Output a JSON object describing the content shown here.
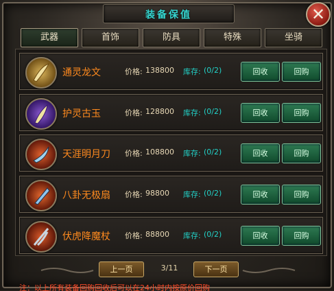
{
  "window": {
    "title": "装备保值",
    "close_glyph": "✕"
  },
  "tabs": [
    {
      "label": "武器",
      "active": true
    },
    {
      "label": "首饰",
      "active": false
    },
    {
      "label": "防具",
      "active": false
    },
    {
      "label": "特殊",
      "active": false
    },
    {
      "label": "坐骑",
      "active": false
    }
  ],
  "items": [
    {
      "name": "通灵龙文",
      "price_label": "价格:",
      "price": "138800",
      "stock_label": "库存:",
      "stock": "(0/2)",
      "sell": "回收",
      "rebuy": "回购",
      "icon": "dragon-blade-icon",
      "color": "#b28c2b"
    },
    {
      "name": "护灵古玉",
      "price_label": "价格:",
      "price": "128800",
      "stock_label": "库存:",
      "stock": "(0/2)",
      "sell": "回收",
      "rebuy": "回购",
      "icon": "jade-blade-icon",
      "color": "#5b2fa0"
    },
    {
      "name": "天涯明月刀",
      "price_label": "价格:",
      "price": "108800",
      "stock_label": "库存:",
      "stock": "(0/2)",
      "sell": "回收",
      "rebuy": "回购",
      "icon": "moon-saber-icon",
      "color": "#b5341c"
    },
    {
      "name": "八卦无极扇",
      "price_label": "价格:",
      "price": "98800",
      "stock_label": "库存:",
      "stock": "(0/2)",
      "sell": "回收",
      "rebuy": "回购",
      "icon": "bagua-fan-icon",
      "color": "#b03a1a"
    },
    {
      "name": "伏虎降魔杖",
      "price_label": "价格:",
      "price": "88800",
      "stock_label": "库存:",
      "stock": "(0/2)",
      "sell": "回收",
      "rebuy": "回购",
      "icon": "tiger-staff-icon",
      "color": "#a2341a"
    }
  ],
  "pager": {
    "prev": "上一页",
    "page": "3/11",
    "next": "下一页"
  },
  "notice": "注：以上所有装备回购回收后可以在24小时内按原价回购"
}
